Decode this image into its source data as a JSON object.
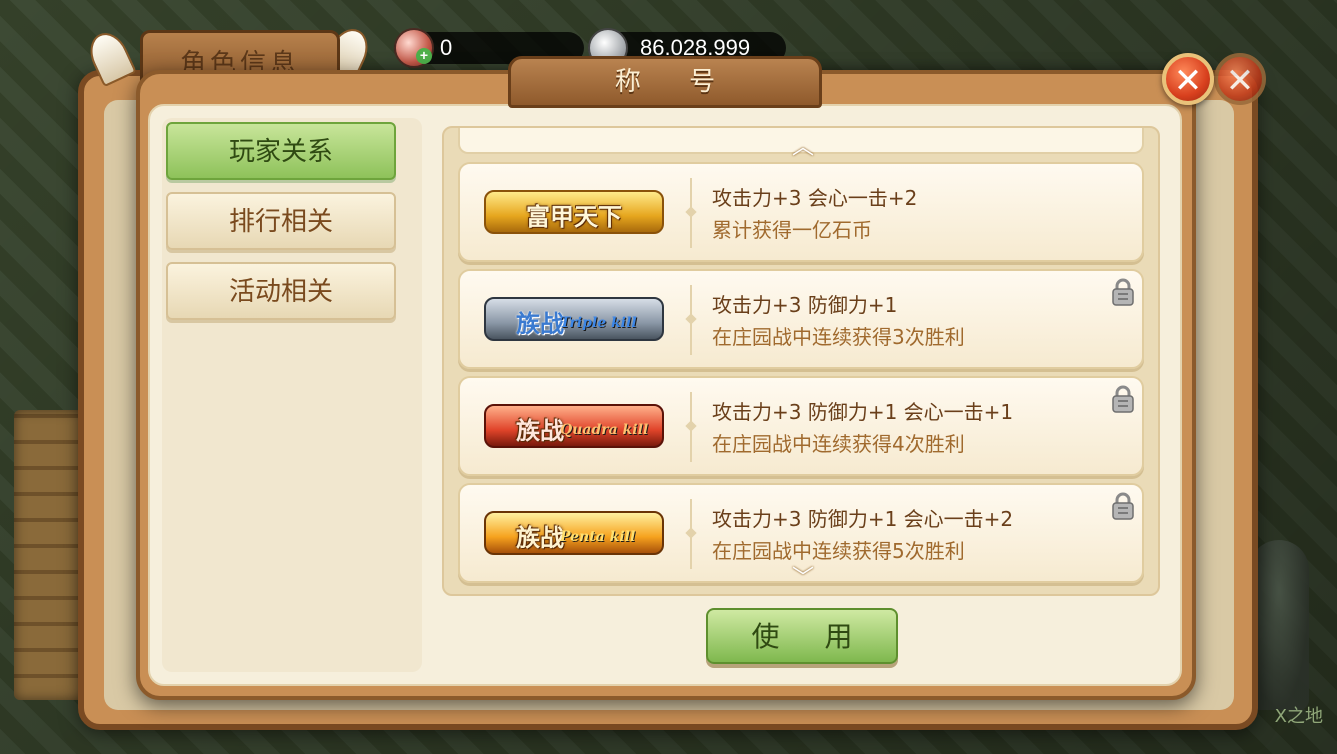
{
  "background_window": {
    "tab_label": "角色信息"
  },
  "currency": {
    "gems": "0",
    "coins": "86.028.999"
  },
  "dialog": {
    "title": "称 号"
  },
  "sidebar": {
    "items": [
      {
        "label": "玩家关系",
        "active": true
      },
      {
        "label": "排行相关",
        "active": false
      },
      {
        "label": "活动相关",
        "active": false
      }
    ]
  },
  "titles": [
    {
      "badge_cn": "富甲天下",
      "badge_en": "",
      "bonus": "攻击力+3 会心一击+2",
      "condition": "累计获得一亿石币",
      "locked": false
    },
    {
      "badge_cn": "族战",
      "badge_en": "Triple kill",
      "bonus": "攻击力+3 防御力+1",
      "condition": "在庄园战中连续获得3次胜利",
      "locked": true
    },
    {
      "badge_cn": "族战",
      "badge_en": "Quadra kill",
      "bonus": "攻击力+3 防御力+1 会心一击+1",
      "condition": "在庄园战中连续获得4次胜利",
      "locked": true
    },
    {
      "badge_cn": "族战",
      "badge_en": "Penta kill",
      "bonus": "攻击力+3 防御力+1 会心一击+2",
      "condition": "在庄园战中连续获得5次胜利",
      "locked": true
    }
  ],
  "use_button": "使 用",
  "watermark": "X之地",
  "colors": {
    "active_green": "#8ec25a",
    "frame_brown": "#c98f55",
    "close_red": "#d8401e"
  }
}
